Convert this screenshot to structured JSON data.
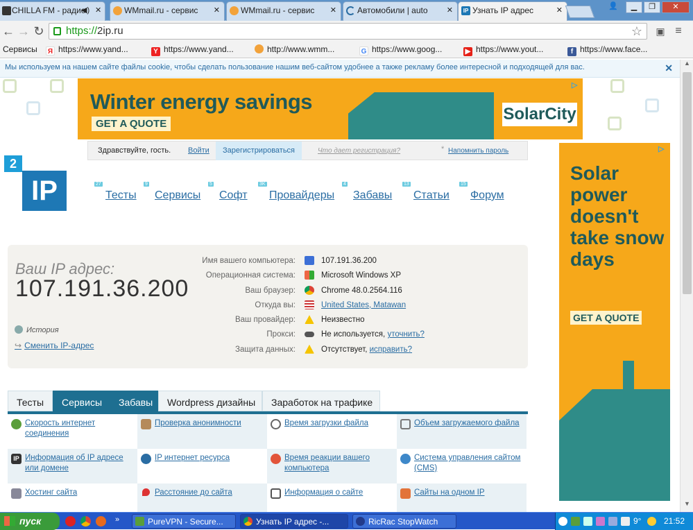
{
  "browser": {
    "tabs": [
      {
        "title": "CHILLA FM - радио"
      },
      {
        "title": "WMmail.ru - сервис"
      },
      {
        "title": "WMmail.ru - сервис"
      },
      {
        "title": "Автомобили | auto"
      },
      {
        "title": "Узнать IP адрес"
      }
    ],
    "url_scheme": "https://",
    "url_host": "2ip.ru",
    "bookmarks": [
      {
        "label": "Сервисы"
      },
      {
        "label": "https://www.yand..."
      },
      {
        "label": "https://www.yand..."
      },
      {
        "label": "http://www.wmm..."
      },
      {
        "label": "https://www.goog..."
      },
      {
        "label": "https://www.yout..."
      },
      {
        "label": "https://www.face..."
      }
    ]
  },
  "cookie_notice": "Мы используем на нашем сайте файлы cookie, чтобы сделать пользование нашим веб-сайтом удобнее а также рекламу более интересной и подходящей для вас.",
  "banner": {
    "headline": "Winter energy savings",
    "cta": "GET A QUOTE",
    "brand": "SolarCity"
  },
  "side_ad": {
    "headline": "Solar power doesn't take snow days",
    "cta": "GET A QUOTE"
  },
  "login": {
    "greeting": "Здравствуйте, гость.",
    "login": "Войти",
    "register": "Зарегистрироваться",
    "what_gives": "Что дает регистрация?",
    "remind": "Напомнить пароль"
  },
  "logo": {
    "two": "2",
    "ip": "IP"
  },
  "nav": [
    {
      "badge": "27",
      "label": "Тесты"
    },
    {
      "badge": "9",
      "label": "Сервисы"
    },
    {
      "badge": "5",
      "label": "Софт"
    },
    {
      "badge": "3K",
      "label": "Провайдеры"
    },
    {
      "badge": "4",
      "label": "Забавы"
    },
    {
      "badge": "13",
      "label": "Статьи"
    },
    {
      "badge": "15",
      "label": "Форум"
    }
  ],
  "ipinfo": {
    "caption": "Ваш IP адрес:",
    "ip": "107.191.36.200",
    "history": "История",
    "change": "Сменить IP-адрес",
    "rows": [
      {
        "key": "Имя вашего компьютера:",
        "value": "107.191.36.200",
        "icon": "computer-icon"
      },
      {
        "key": "Операционная система:",
        "value": "Microsoft Windows XP",
        "icon": "windows-icon"
      },
      {
        "key": "Ваш браузер:",
        "value": "Chrome 48.0.2564.116",
        "icon": "chrome-icon"
      },
      {
        "key": "Откуда вы:",
        "value": "United States, Matawan",
        "icon": "us-flag-icon"
      },
      {
        "key": "Ваш провайдер:",
        "value": "Неизвестно",
        "icon": "warning-icon"
      },
      {
        "key": "Прокси:",
        "value": "Не используется,",
        "link": "уточнить?",
        "icon": "glasses-icon"
      },
      {
        "key": "Защита данных:",
        "value": "Отсутствует,",
        "link": "исправить?",
        "icon": "warning-icon"
      }
    ]
  },
  "section_tabs": [
    {
      "label": "Тесты"
    },
    {
      "label": "Сервисы"
    },
    {
      "label": "Забавы"
    },
    {
      "label": "Wordpress дизайны"
    },
    {
      "label": "Заработок на трафике"
    }
  ],
  "services": [
    {
      "label": "Скорость интернет соединения"
    },
    {
      "label": "Проверка анонимности"
    },
    {
      "label": "Время загрузки файла"
    },
    {
      "label": "Объем загружаемого файла"
    },
    {
      "label": "Информация об IP адресе или домене"
    },
    {
      "label": "IP интернет ресурса"
    },
    {
      "label": "Время реакции вашего компьютера"
    },
    {
      "label": "Система управления сайтом (CMS)"
    },
    {
      "label": "Хостинг сайта"
    },
    {
      "label": "Расстояние до сайта"
    },
    {
      "label": "Информация о сайте"
    },
    {
      "label": "Сайты на одном IP"
    }
  ],
  "taskbar": {
    "start": "пуск",
    "windows": [
      {
        "label": "PureVPN - Secure..."
      },
      {
        "label": "Узнать IP адрес -..."
      },
      {
        "label": "RicRac StopWatch"
      }
    ],
    "temp": "9°",
    "clock": "21:52"
  }
}
